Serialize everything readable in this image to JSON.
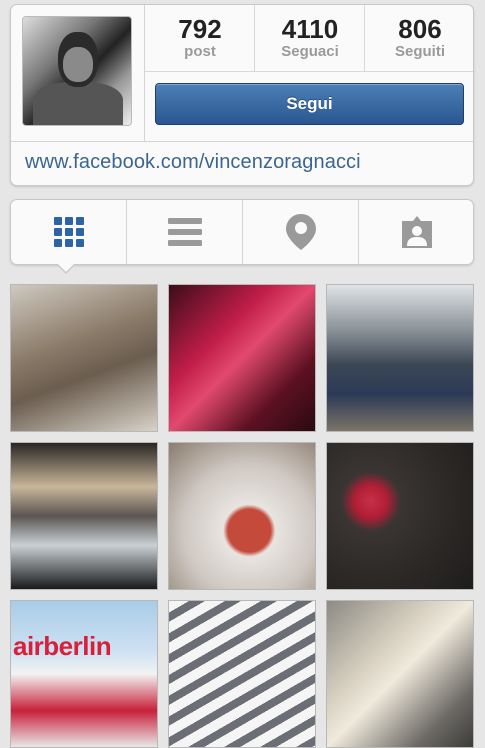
{
  "profile": {
    "avatar_alt": "profile-photo",
    "stats": [
      {
        "value": "792",
        "label": "post"
      },
      {
        "value": "4110",
        "label": "Seguaci"
      },
      {
        "value": "806",
        "label": "Seguiti"
      }
    ],
    "follow_label": "Segui",
    "website": "www.facebook.com/vincenzoragnacci"
  },
  "tabs": [
    {
      "name": "grid-view",
      "icon": "grid-icon",
      "active": true
    },
    {
      "name": "list-view",
      "icon": "list-icon",
      "active": false
    },
    {
      "name": "photo-map",
      "icon": "map-pin-icon",
      "active": false
    },
    {
      "name": "tagged-photos",
      "icon": "tagged-person-icon",
      "active": false
    }
  ],
  "colors": {
    "accent": "#2a5791",
    "active_icon": "#2e63a5",
    "inactive_icon": "#9a9a9a",
    "link": "#3c668f"
  },
  "photos": [
    {
      "caption": ""
    },
    {
      "caption": ""
    },
    {
      "caption": ""
    },
    {
      "caption": ""
    },
    {
      "caption": ""
    },
    {
      "caption": ""
    },
    {
      "caption": "airberlin"
    },
    {
      "caption": ""
    },
    {
      "caption": ""
    }
  ]
}
